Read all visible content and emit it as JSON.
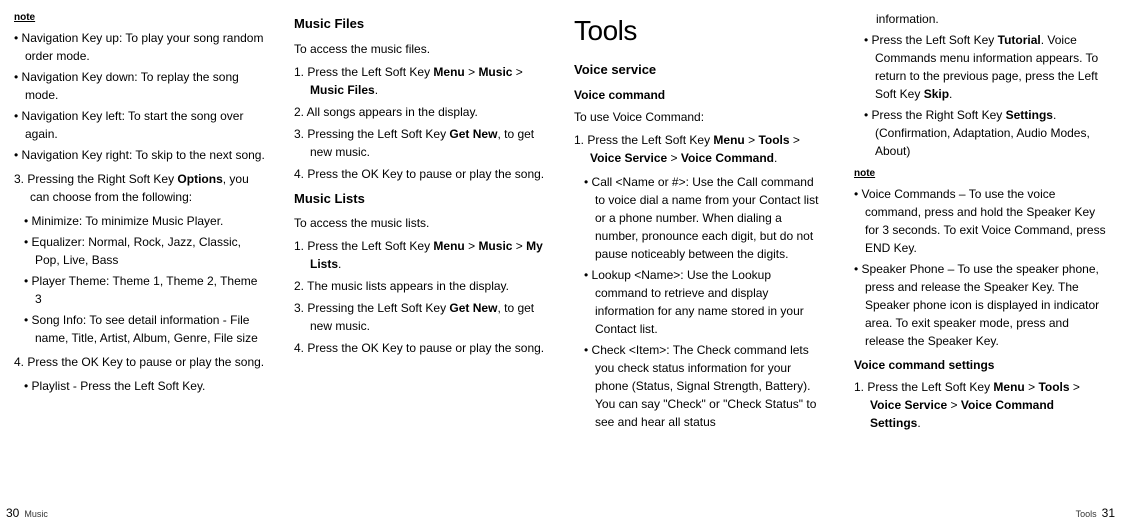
{
  "col1": {
    "note_label": "note",
    "nav_items": [
      "Navigation Key up: To play your song random order mode.",
      "Navigation Key down: To replay the song mode.",
      "Navigation Key left: To start the song over again.",
      "Navigation Key right: To skip to the next song."
    ],
    "step3_prefix": "3. Pressing the Right Soft Key ",
    "step3_bold": "Options",
    "step3_suffix": ", you can choose from the following:",
    "options_items": [
      "Minimize: To minimize Music Player.",
      "Equalizer: Normal, Rock, Jazz, Classic, Pop, Live, Bass",
      "Player Theme: Theme 1, Theme 2, Theme 3",
      "Song Info: To see detail information - File name, Title, Artist, Album, Genre, File size"
    ],
    "step4": "4. Press the OK Key to pause or play the song.",
    "playlist": "Playlist - Press the Left Soft Key."
  },
  "col2": {
    "h_music_files": "Music Files",
    "music_files_intro": "To access the music files.",
    "mf_step1_a": "1. Press the Left Soft Key ",
    "mf_step1_b1": "Menu",
    "mf_step1_gt1": " > ",
    "mf_step1_b2": "Music",
    "mf_step1_gt2": " > ",
    "mf_step1_b3": "Music Files",
    "mf_step1_end": ".",
    "mf_step2": "2. All songs appears in the display.",
    "mf_step3_a": "3. Pressing the Left Soft Key ",
    "mf_step3_b": "Get New",
    "mf_step3_c": ", to get new music.",
    "mf_step4": "4. Press the OK Key to pause or play the song.",
    "h_music_lists": "Music Lists",
    "music_lists_intro": "To access the music lists.",
    "ml_step1_a": "1. Press the Left Soft Key ",
    "ml_step1_b1": "Menu",
    "ml_step1_gt1": " > ",
    "ml_step1_b2": "Music",
    "ml_step1_gt2": " > ",
    "ml_step1_b3": "My Lists",
    "ml_step1_end": ".",
    "ml_step2": "2. The music lists appears in the display.",
    "ml_step3_a": "3. Pressing the Left Soft Key ",
    "ml_step3_b": "Get New",
    "ml_step3_c": ", to get new music.",
    "ml_step4": "4. Press the OK Key to pause or play the song."
  },
  "col3": {
    "h_tools": "Tools",
    "h_voice_service": "Voice service",
    "h_voice_command": "Voice command",
    "vc_intro": "To use Voice Command:",
    "vc_step1_a": "1. Press the Left Soft Key ",
    "vc_step1_b1": "Menu",
    "vc_step1_gt1": " > ",
    "vc_step1_b2": "Tools",
    "vc_step1_gt2": " > ",
    "vc_step1_b3": "Voice Service",
    "vc_step1_gt3": " > ",
    "vc_step1_b4": "Voice Command",
    "vc_step1_end": ".",
    "vc_items": [
      "Call <Name or #>: Use the Call command to voice dial a name from your Contact list or a phone number. When dialing a number, pronounce each digit, but do not pause noticeably between the digits.",
      "Lookup <Name>: Use the Lookup command to retrieve and display information for any name stored in your Contact list.",
      "Check <Item>: The Check command lets you check status information for your phone (Status, Signal Strength, Battery). You can say \"Check\" or \"Check Status\" to see and hear all status"
    ]
  },
  "col4": {
    "cont_item0": "information.",
    "cont_item1_a": "Press the Left Soft Key ",
    "cont_item1_b1": "Tutorial",
    "cont_item1_c": ". Voice Commands menu information appears. To return to the previous page, press the Left Soft Key ",
    "cont_item1_b2": "Skip",
    "cont_item1_end": ".",
    "cont_item2_a": "Press the Right Soft Key ",
    "cont_item2_b": "Settings",
    "cont_item2_c": ". (Confirmation, Adaptation, Audio Modes, About)",
    "note_label": "note",
    "note_items": [
      "Voice Commands – To use the voice command, press and hold the Speaker Key for 3 seconds. To exit Voice Command, press END Key.",
      "Speaker Phone – To use the speaker phone, press and release the Speaker Key. The Speaker phone icon is displayed in indicator area. To exit speaker mode, press and release the Speaker Key."
    ],
    "h_vc_settings": "Voice command settings",
    "vcs_step1_a": "1. Press the Left Soft Key ",
    "vcs_step1_b1": "Menu",
    "vcs_step1_gt1": " > ",
    "vcs_step1_b2": "Tools",
    "vcs_step1_gt2": " > ",
    "vcs_step1_b3": "Voice Service",
    "vcs_step1_gt3": " > ",
    "vcs_step1_b4": "Voice Command Settings",
    "vcs_step1_end": "."
  },
  "footer": {
    "left_num": "30",
    "left_label": "Music",
    "right_label": "Tools",
    "right_num": "31"
  }
}
